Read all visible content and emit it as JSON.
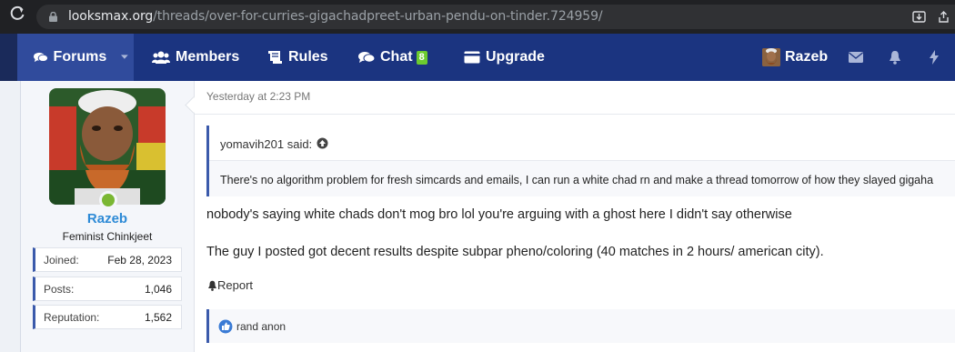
{
  "browser": {
    "url_host": "looksmax.org",
    "url_path": "/threads/over-for-curries-gigachadpreet-urban-pendu-on-tinder.724959/"
  },
  "nav": {
    "forums": "Forums",
    "members": "Members",
    "rules": "Rules",
    "chat": "Chat",
    "chat_badge": "8",
    "upgrade": "Upgrade",
    "username": "Razeb"
  },
  "user": {
    "name": "Razeb",
    "title": "Feminist Chinkjeet",
    "stats": [
      {
        "label": "Joined:",
        "value": "Feb 28, 2023"
      },
      {
        "label": "Posts:",
        "value": "1,046"
      },
      {
        "label": "Reputation:",
        "value": "1,562"
      }
    ],
    "online": true
  },
  "post": {
    "timestamp": "Yesterday at 2:23 PM",
    "quote_author": "yomavih201 said:",
    "quote_text": "There's no algorithm problem for fresh simcards and emails, I can run a white chad rn and make a thread tomorrow of how they slayed gigaha",
    "body": [
      "nobody's saying white chads don't mog bro lol you're arguing with a ghost here I didn't say otherwise",
      "The guy I posted got decent results despite subpar pheno/coloring (40 matches in 2 hours/ american city)."
    ],
    "report": "Report",
    "reaction_user": "rand anon"
  },
  "colors": {
    "nav_bg": "#1b3480",
    "accent": "#3b5aab",
    "username": "#2d8ad6",
    "online": "#7ab733",
    "chat_badge": "#6ccb2f"
  }
}
